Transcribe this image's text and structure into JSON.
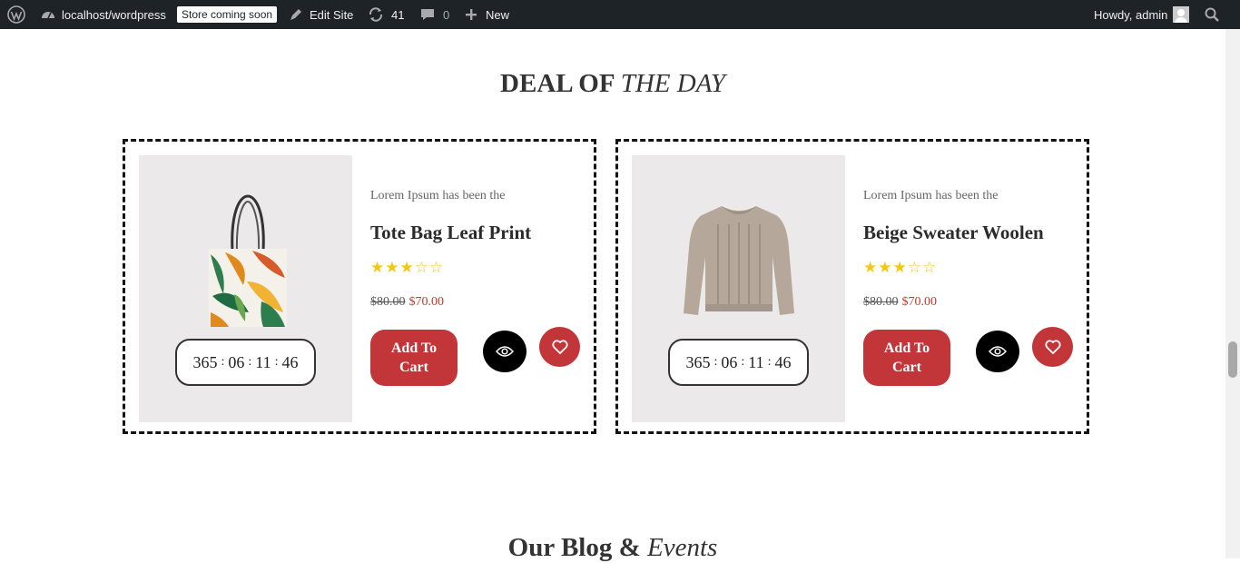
{
  "adminbar": {
    "site_name": "localhost/wordpress",
    "store_badge": "Store coming soon",
    "edit_site": "Edit Site",
    "updates_count": "41",
    "comments_count": "0",
    "new_label": "New",
    "howdy": "Howdy, admin",
    "icons": [
      "wordpress-logo-icon",
      "dashboard-icon",
      "edit-site-icon",
      "updates-icon",
      "comments-icon",
      "plus-icon",
      "avatar",
      "search-icon"
    ]
  },
  "deal": {
    "title_main": "DEAL OF",
    "title_em": "THE DAY"
  },
  "products": [
    {
      "description": "Lorem Ipsum has been the",
      "name": "Tote Bag Leaf Print",
      "rating": 3,
      "rating_max": 5,
      "old_price": "$80.00",
      "new_price": "$70.00",
      "cart_label": "Add To Cart",
      "timer": {
        "days": "365",
        "hours": "06",
        "minutes": "11",
        "seconds": "46"
      },
      "image": "tote-bag-image"
    },
    {
      "description": "Lorem Ipsum has been the",
      "name": "Beige Sweater Woolen",
      "rating": 3,
      "rating_max": 5,
      "old_price": "$80.00",
      "new_price": "$70.00",
      "cart_label": "Add To Cart",
      "timer": {
        "days": "365",
        "hours": "06",
        "minutes": "11",
        "seconds": "46"
      },
      "image": "sweater-image"
    }
  ],
  "blog": {
    "title_main": "Our Blog &",
    "title_em": "Events"
  },
  "colors": {
    "adminbar_bg": "#1d2327",
    "accent_red": "#c2363a",
    "star_yellow": "#f5c518",
    "image_bg": "#ebe9e9"
  }
}
